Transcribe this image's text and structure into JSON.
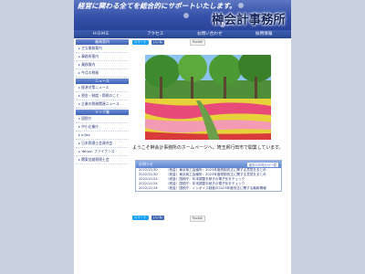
{
  "header": {
    "tagline": "経営に関わる全てを総合的にサポートいたします。",
    "logo": "榊会計事務所"
  },
  "nav": [
    "ＨＯＭＥ",
    "アクセス",
    "お問い合わせ",
    "採用情報"
  ],
  "sidebar": {
    "section1_title": "業務案内",
    "section1_items": [
      "主な業務案内",
      "事務所案内",
      "業務案内",
      "今月の税務"
    ],
    "section2_title": "ニュース",
    "section2_items": [
      "経済対策ニュース",
      "税金・制度・節税のこと",
      "企業の税務関連ニュース"
    ],
    "section3_title": "リンク集",
    "section3_items": [
      "国税庁",
      "中小企業庁",
      "e-Tax",
      "日本税理士会連合会",
      "Yahoo! ファイナンス",
      "関東信越税理士会"
    ]
  },
  "share": {
    "twitter": "ツイート",
    "facebook": "いいね",
    "pocket": "Pocket"
  },
  "welcome": "ようこそ榊会計事務所のホームページへ。埼玉県行田市で開業しています。",
  "news": {
    "title": "お知らせ",
    "more": "過去のお知らせ一覧",
    "items": [
      {
        "date": "2022/11/30",
        "text": "（税金）東京商工会議所：2023年度税制改正に関する意見をまとめ"
      },
      {
        "date": "2022/11/30",
        "text": "（税金）東京商工会議所：2023年度税制改正に関する意見をまとめ"
      },
      {
        "date": "2022/11/24",
        "text": "（税金）国税庁：年末調整手続きの電子化をチェック"
      },
      {
        "date": "2022/11/24",
        "text": "（税金）国税庁：年末調整手続きの電子化をチェック"
      },
      {
        "date": "2022/11/16",
        "text": "（税金）国税庁：インボイス制度の2023年度改正に関する最新情報"
      }
    ]
  }
}
